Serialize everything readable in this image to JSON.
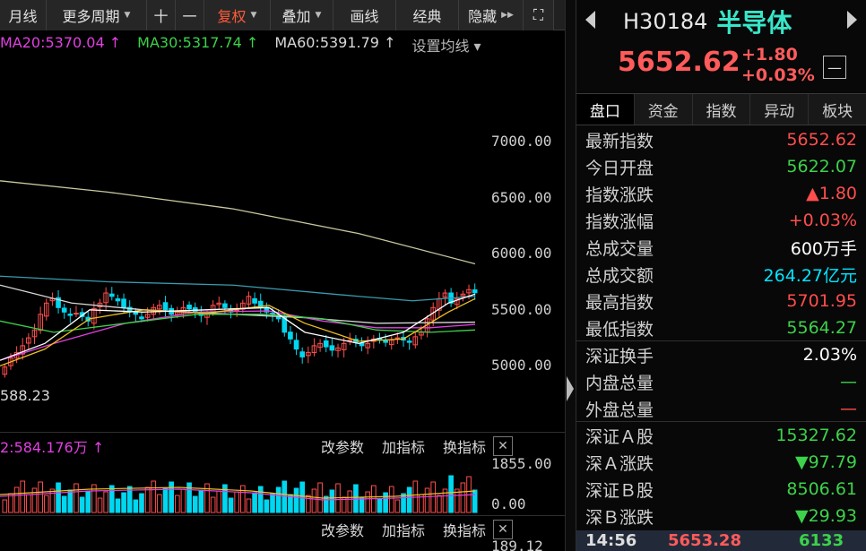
{
  "toolbar": {
    "items": [
      {
        "label": "月线",
        "name": "monthly-line-button"
      },
      {
        "label": "更多周期",
        "name": "more-periods-dropdown",
        "caret": true
      },
      {
        "label": "十",
        "name": "zoom-in-button"
      },
      {
        "label": "一",
        "name": "zoom-out-button"
      },
      {
        "label": "复权",
        "name": "adjust-rights-dropdown",
        "caret": true,
        "red": true
      },
      {
        "label": "叠加",
        "name": "overlay-dropdown",
        "caret": true
      },
      {
        "label": "画线",
        "name": "draw-line-button"
      },
      {
        "label": "经典",
        "name": "classic-button"
      },
      {
        "label": "隐藏",
        "name": "hide-button",
        "arrows": true
      },
      {
        "label": "⛶",
        "name": "fullscreen-icon"
      }
    ]
  },
  "ma_legend": [
    {
      "text": "MA20:5370.04 ↑",
      "color": "#e040e0"
    },
    {
      "text": "MA30:5317.74 ↑",
      "color": "#3cd24a"
    },
    {
      "text": "MA60:5391.79 ↑",
      "color": "#d8d8d8"
    },
    {
      "text": "设置均线 ▾",
      "color": "#b8b8b8"
    }
  ],
  "price_axis": [
    "7000.00",
    "6500.00",
    "6000.00",
    "5500.00",
    "5000.00"
  ],
  "low_label": "588.23",
  "volume": {
    "legend": "2:584.176万 ↑",
    "legend_color": "#e040e0",
    "axis": [
      "1855.00",
      "0.00"
    ]
  },
  "indicator_buttons": [
    "改参数",
    "加指标",
    "换指标"
  ],
  "bottom_axis": "189.12",
  "right": {
    "code": "H30184",
    "name": "半导体",
    "price": "5652.62",
    "change": "+1.80",
    "change_pct": "+0.03%",
    "minus_label": "—",
    "tabs": [
      "盘口",
      "资金",
      "指数",
      "异动",
      "板块"
    ],
    "rows": [
      {
        "label": "最新指数",
        "value": "5652.62",
        "color": "#ff4d4d"
      },
      {
        "label": "今日开盘",
        "value": "5622.07",
        "color": "#3cd24a"
      },
      {
        "label": "指数涨跌",
        "value": "▲1.80",
        "color": "#ff4d4d"
      },
      {
        "label": "指数涨幅",
        "value": "+0.03%",
        "color": "#ff4d4d"
      },
      {
        "label": "总成交量",
        "value": "600万手",
        "color": "#ffffff"
      },
      {
        "label": "总成交额",
        "value": "264.27亿元",
        "color": "#00e5ff"
      },
      {
        "label": "最高指数",
        "value": "5701.95",
        "color": "#ff4d4d"
      },
      {
        "label": "最低指数",
        "value": "5564.27",
        "color": "#3cd24a"
      },
      {
        "label": "深证换手",
        "value": "2.03%",
        "color": "#ffffff"
      },
      {
        "label": "内盘总量",
        "value": "—",
        "color": "#3cd24a"
      },
      {
        "label": "外盘总量",
        "value": "—",
        "color": "#ff4d4d"
      },
      {
        "label": "深证Ａ股",
        "value": "15327.62",
        "color": "#3cd24a"
      },
      {
        "label": "深Ａ涨跌",
        "value": "▼97.79",
        "color": "#3cd24a"
      },
      {
        "label": "深证Ｂ股",
        "value": "8506.61",
        "color": "#3cd24a"
      },
      {
        "label": "深Ｂ涨跌",
        "value": "▼29.93",
        "color": "#3cd24a"
      }
    ],
    "footer": {
      "time": "14:56",
      "price": "5653.28",
      "vol": "6133"
    }
  }
}
